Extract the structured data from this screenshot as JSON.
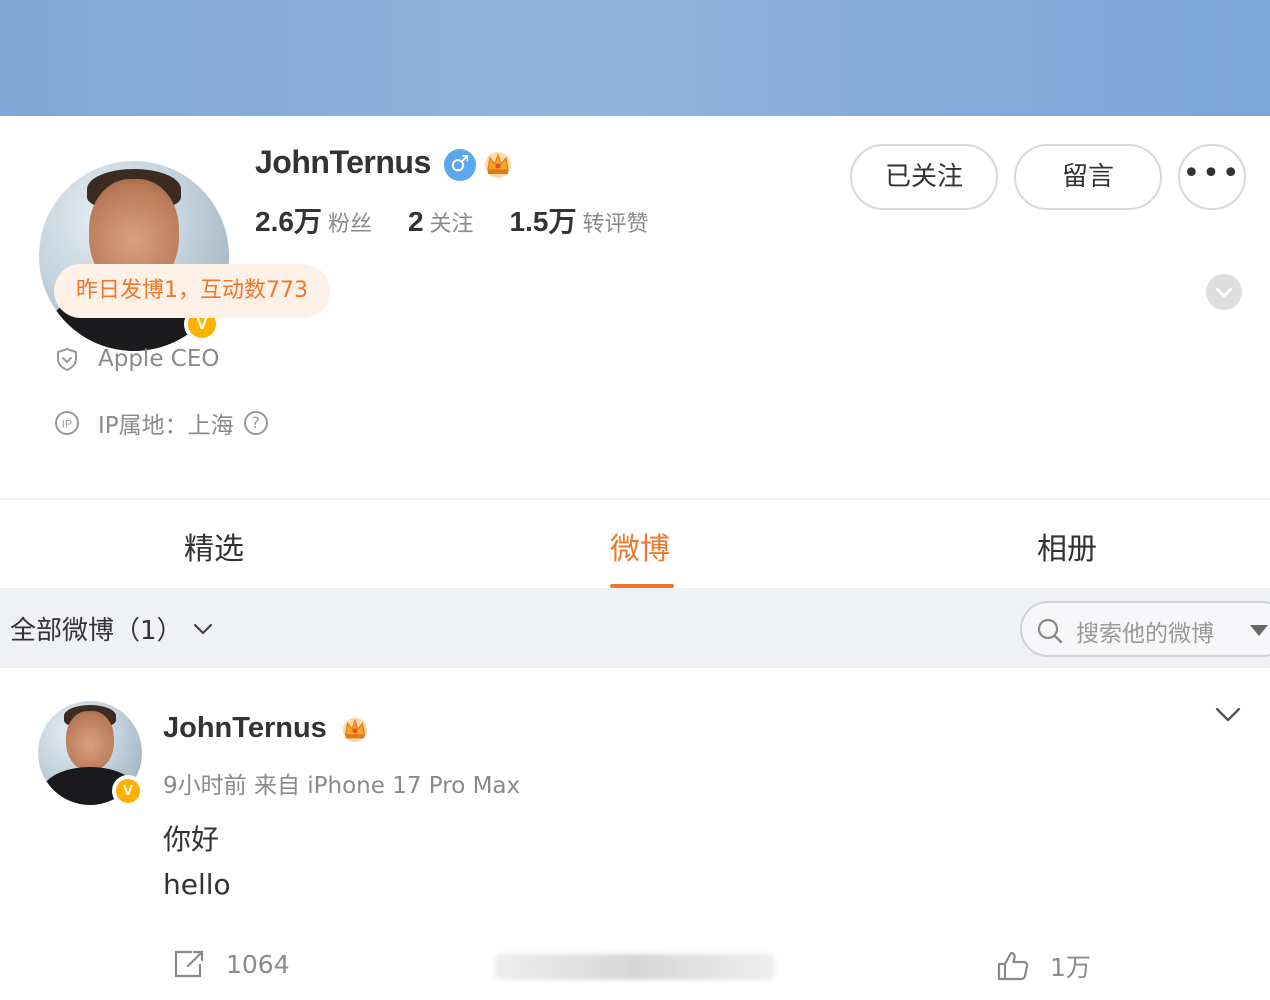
{
  "profile": {
    "name": "JohnTernus",
    "gender_icon": "male-symbol-icon",
    "crown_icon": "crown-icon",
    "verified_badge": "V",
    "stats": [
      {
        "value": "2.6万",
        "label": "粉丝"
      },
      {
        "value": "2",
        "label": "关注"
      },
      {
        "value": "1.5万",
        "label": "转评赞"
      }
    ],
    "buttons": {
      "follow": "已关注",
      "message": "留言",
      "more": "•••"
    },
    "activity": "昨日发博1，互动数773",
    "bio": "Apple CEO",
    "ip_location": "IP属地：上海",
    "ip_help": "?"
  },
  "tabs": [
    "精选",
    "微博",
    "相册"
  ],
  "active_tab": "微博",
  "filter": {
    "label": "全部微博（1）",
    "search_placeholder": "搜索他的微博"
  },
  "post": {
    "author": "JohnTernus",
    "verified_badge": "V",
    "meta": "9小时前  来自 iPhone 17 Pro Max",
    "lines": [
      "你好",
      "hello"
    ],
    "share_count": "1064",
    "like_count": "1万"
  },
  "colors": {
    "accent": "#f0762a",
    "banner": "#8fb4dc",
    "verified": "#ffb100",
    "gender": "#5aa7ef",
    "activity_bg": "#fdf1e7",
    "filter_bg": "#f0f1f4"
  }
}
